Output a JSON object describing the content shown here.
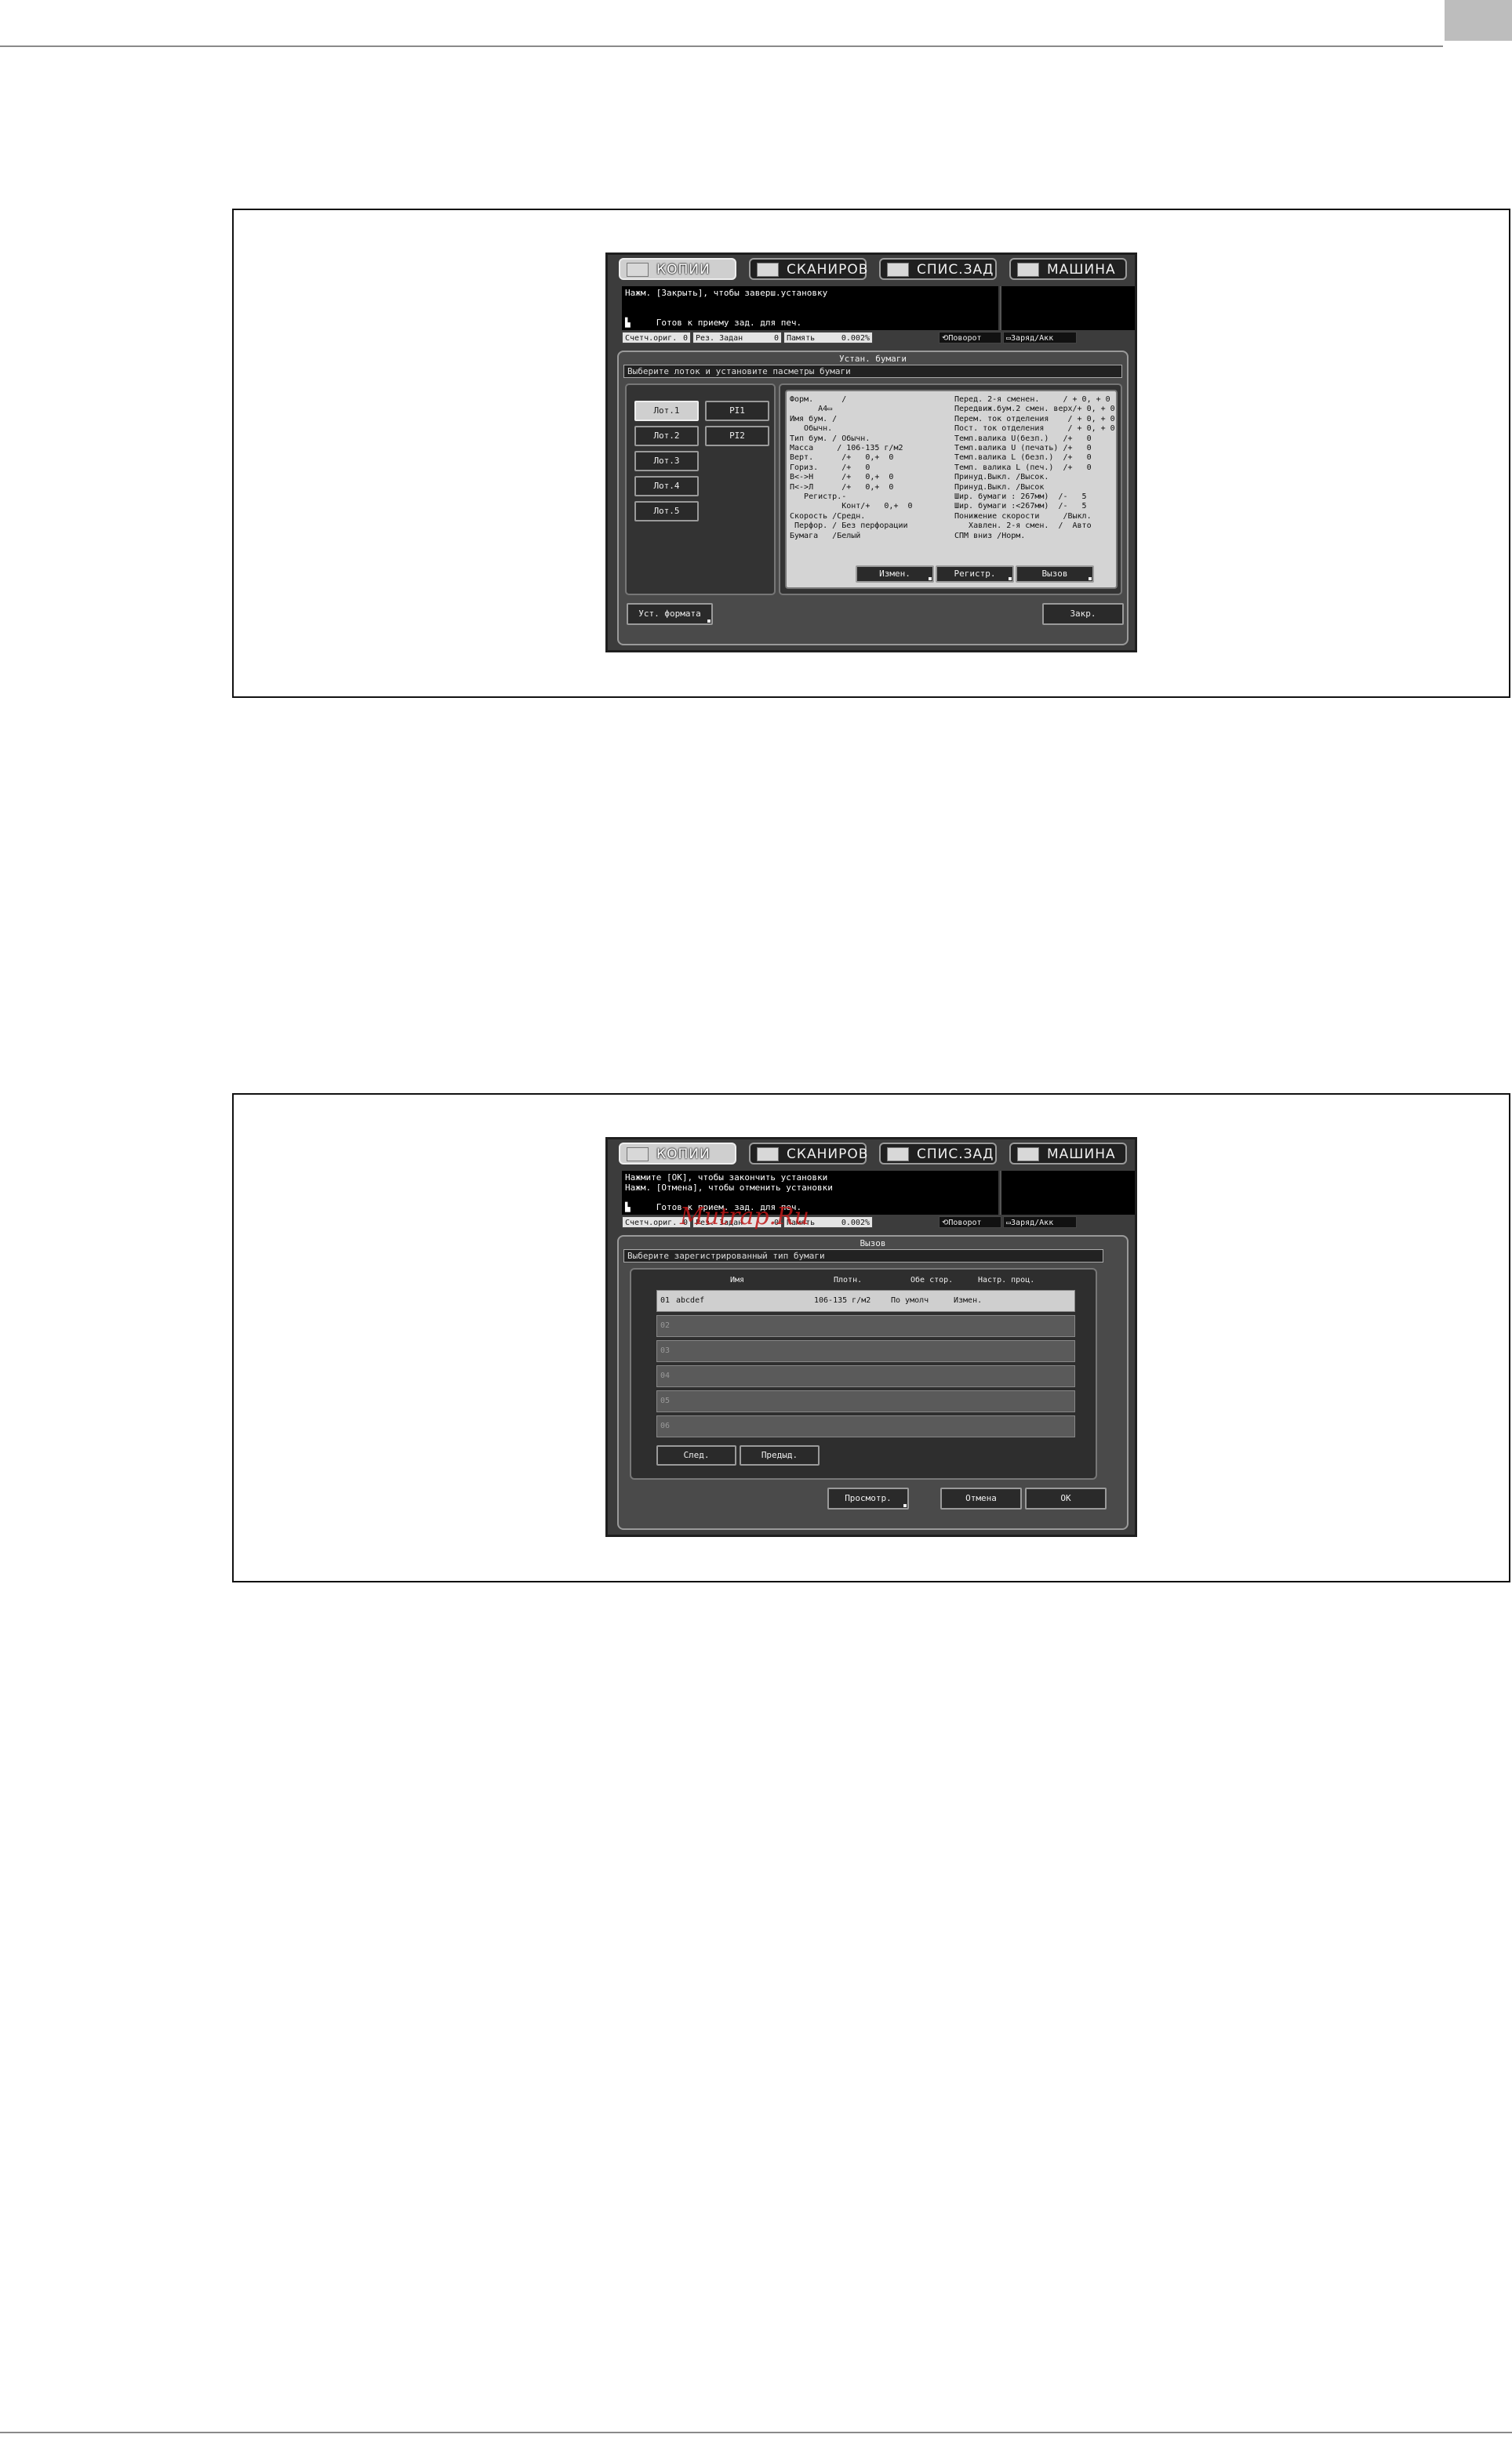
{
  "screen1": {
    "tabs": [
      {
        "label": "КОПИИ",
        "icon": "copy-icon"
      },
      {
        "label": "СКАНИРОВ",
        "icon": "scan-icon"
      },
      {
        "label": "СПИС.ЗАД",
        "icon": "job-list-icon"
      },
      {
        "label": "МАШИНА",
        "icon": "machine-icon"
      }
    ],
    "message_line1": "Нажм. [Закрыть], чтобы заверш.установку",
    "ready": "Готов к приему зад. для печ.",
    "status": [
      "Счетч.ориг.",
      "0",
      "Рез. Задан",
      "0",
      "Память",
      "0.002%",
      "Поворот",
      "Заряд/Акк"
    ],
    "panel_title": "Устан. бумаги",
    "panel_subtitle": "Выберите лоток и установите пасметры бумаги",
    "trays": [
      "Лот.1",
      "Лот.2",
      "Лот.3",
      "Лот.4",
      "Лот.5"
    ],
    "pi_trays": [
      "PI1",
      "PI2"
    ],
    "info_left": [
      "Форм.      /",
      "      A4▭",
      "Имя бум. /",
      "   Обычн.",
      "Тип бум. / Обычн.",
      "Масса     / 106-135 г/м2",
      "Верт.      /+   0,+  0",
      "Гориз.     /+   0",
      "В<->Н      /+   0,+  0",
      "П<->Л      /+   0,+  0",
      "   Регистр.-",
      "           Конт/+   0,+  0",
      "Скорость /Средн.",
      " Перфор. / Без перфорации",
      "Бумага   /Белый"
    ],
    "info_right": [
      "Перед. 2-я сменен.     / + 0, + 0",
      "Передвиж.бум.2 смен. верх/+ 0, + 0",
      "Перем. ток отделения    / + 0, + 0",
      "Пост. ток отделения     / + 0, + 0",
      "Темп.валика U(безп.)   /+   0",
      "Темп.валика U (печать) /+   0",
      "Темп.валика L (безп.)  /+   0",
      "Темп. валика L (печ.)  /+   0",
      "Принуд.Выкл. /Высок.",
      "Принуд.Выкл. /Высок",
      "Шир. бумаги : 267мм)  /-   5",
      "Шир. бумаги :<267мм)  /-   5",
      "Понижение скорости     /Выкл.",
      "   Хавлен. 2-я смен.  /  Авто",
      "СПМ вниз /Норм."
    ],
    "info_buttons": [
      "Измен.",
      "Регистр.",
      "Вызов"
    ],
    "format_button": "Уст. формата",
    "close_button": "Закр."
  },
  "screen2": {
    "tabs": [
      {
        "label": "КОПИИ",
        "icon": "copy-icon"
      },
      {
        "label": "СКАНИРОВ",
        "icon": "scan-icon"
      },
      {
        "label": "СПИС.ЗАД",
        "icon": "job-list-icon"
      },
      {
        "label": "МАШИНА",
        "icon": "machine-icon"
      }
    ],
    "message_line1": "Нажмите [OK], чтобы закончить установки",
    "message_line2": "Нажм. [Отмена], чтобы отменить установки",
    "ready": "Готов к прием. зад. для печ.",
    "status": [
      "Счетч.ориг.",
      "0",
      "Рез. Задан",
      "0",
      "Память",
      "0.002%",
      "Поворот",
      "Заряд/Акк"
    ],
    "watermark": "Mutrap.Ru",
    "panel_title": "Вызов",
    "panel_subtitle": "Выберите зарегистрированный тип бумаги",
    "columns": [
      "Имя",
      "Плотн.",
      "Обе стор.",
      "Настр. проц."
    ],
    "rows": [
      {
        "num": "01",
        "name": "abcdef",
        "weight": "106-135 г/м2",
        "both": "По умолч",
        "proc": "Измен."
      },
      {
        "num": "02",
        "name": "",
        "weight": "",
        "both": "",
        "proc": ""
      },
      {
        "num": "03",
        "name": "",
        "weight": "",
        "both": "",
        "proc": ""
      },
      {
        "num": "04",
        "name": "",
        "weight": "",
        "both": "",
        "proc": ""
      },
      {
        "num": "05",
        "name": "",
        "weight": "",
        "both": "",
        "proc": ""
      },
      {
        "num": "06",
        "name": "",
        "weight": "",
        "both": "",
        "proc": ""
      }
    ],
    "next_button": "След.",
    "prev_button": "Предыд.",
    "preview_button": "Просмотр.",
    "cancel_button": "Отмена",
    "ok_button": "OK"
  }
}
